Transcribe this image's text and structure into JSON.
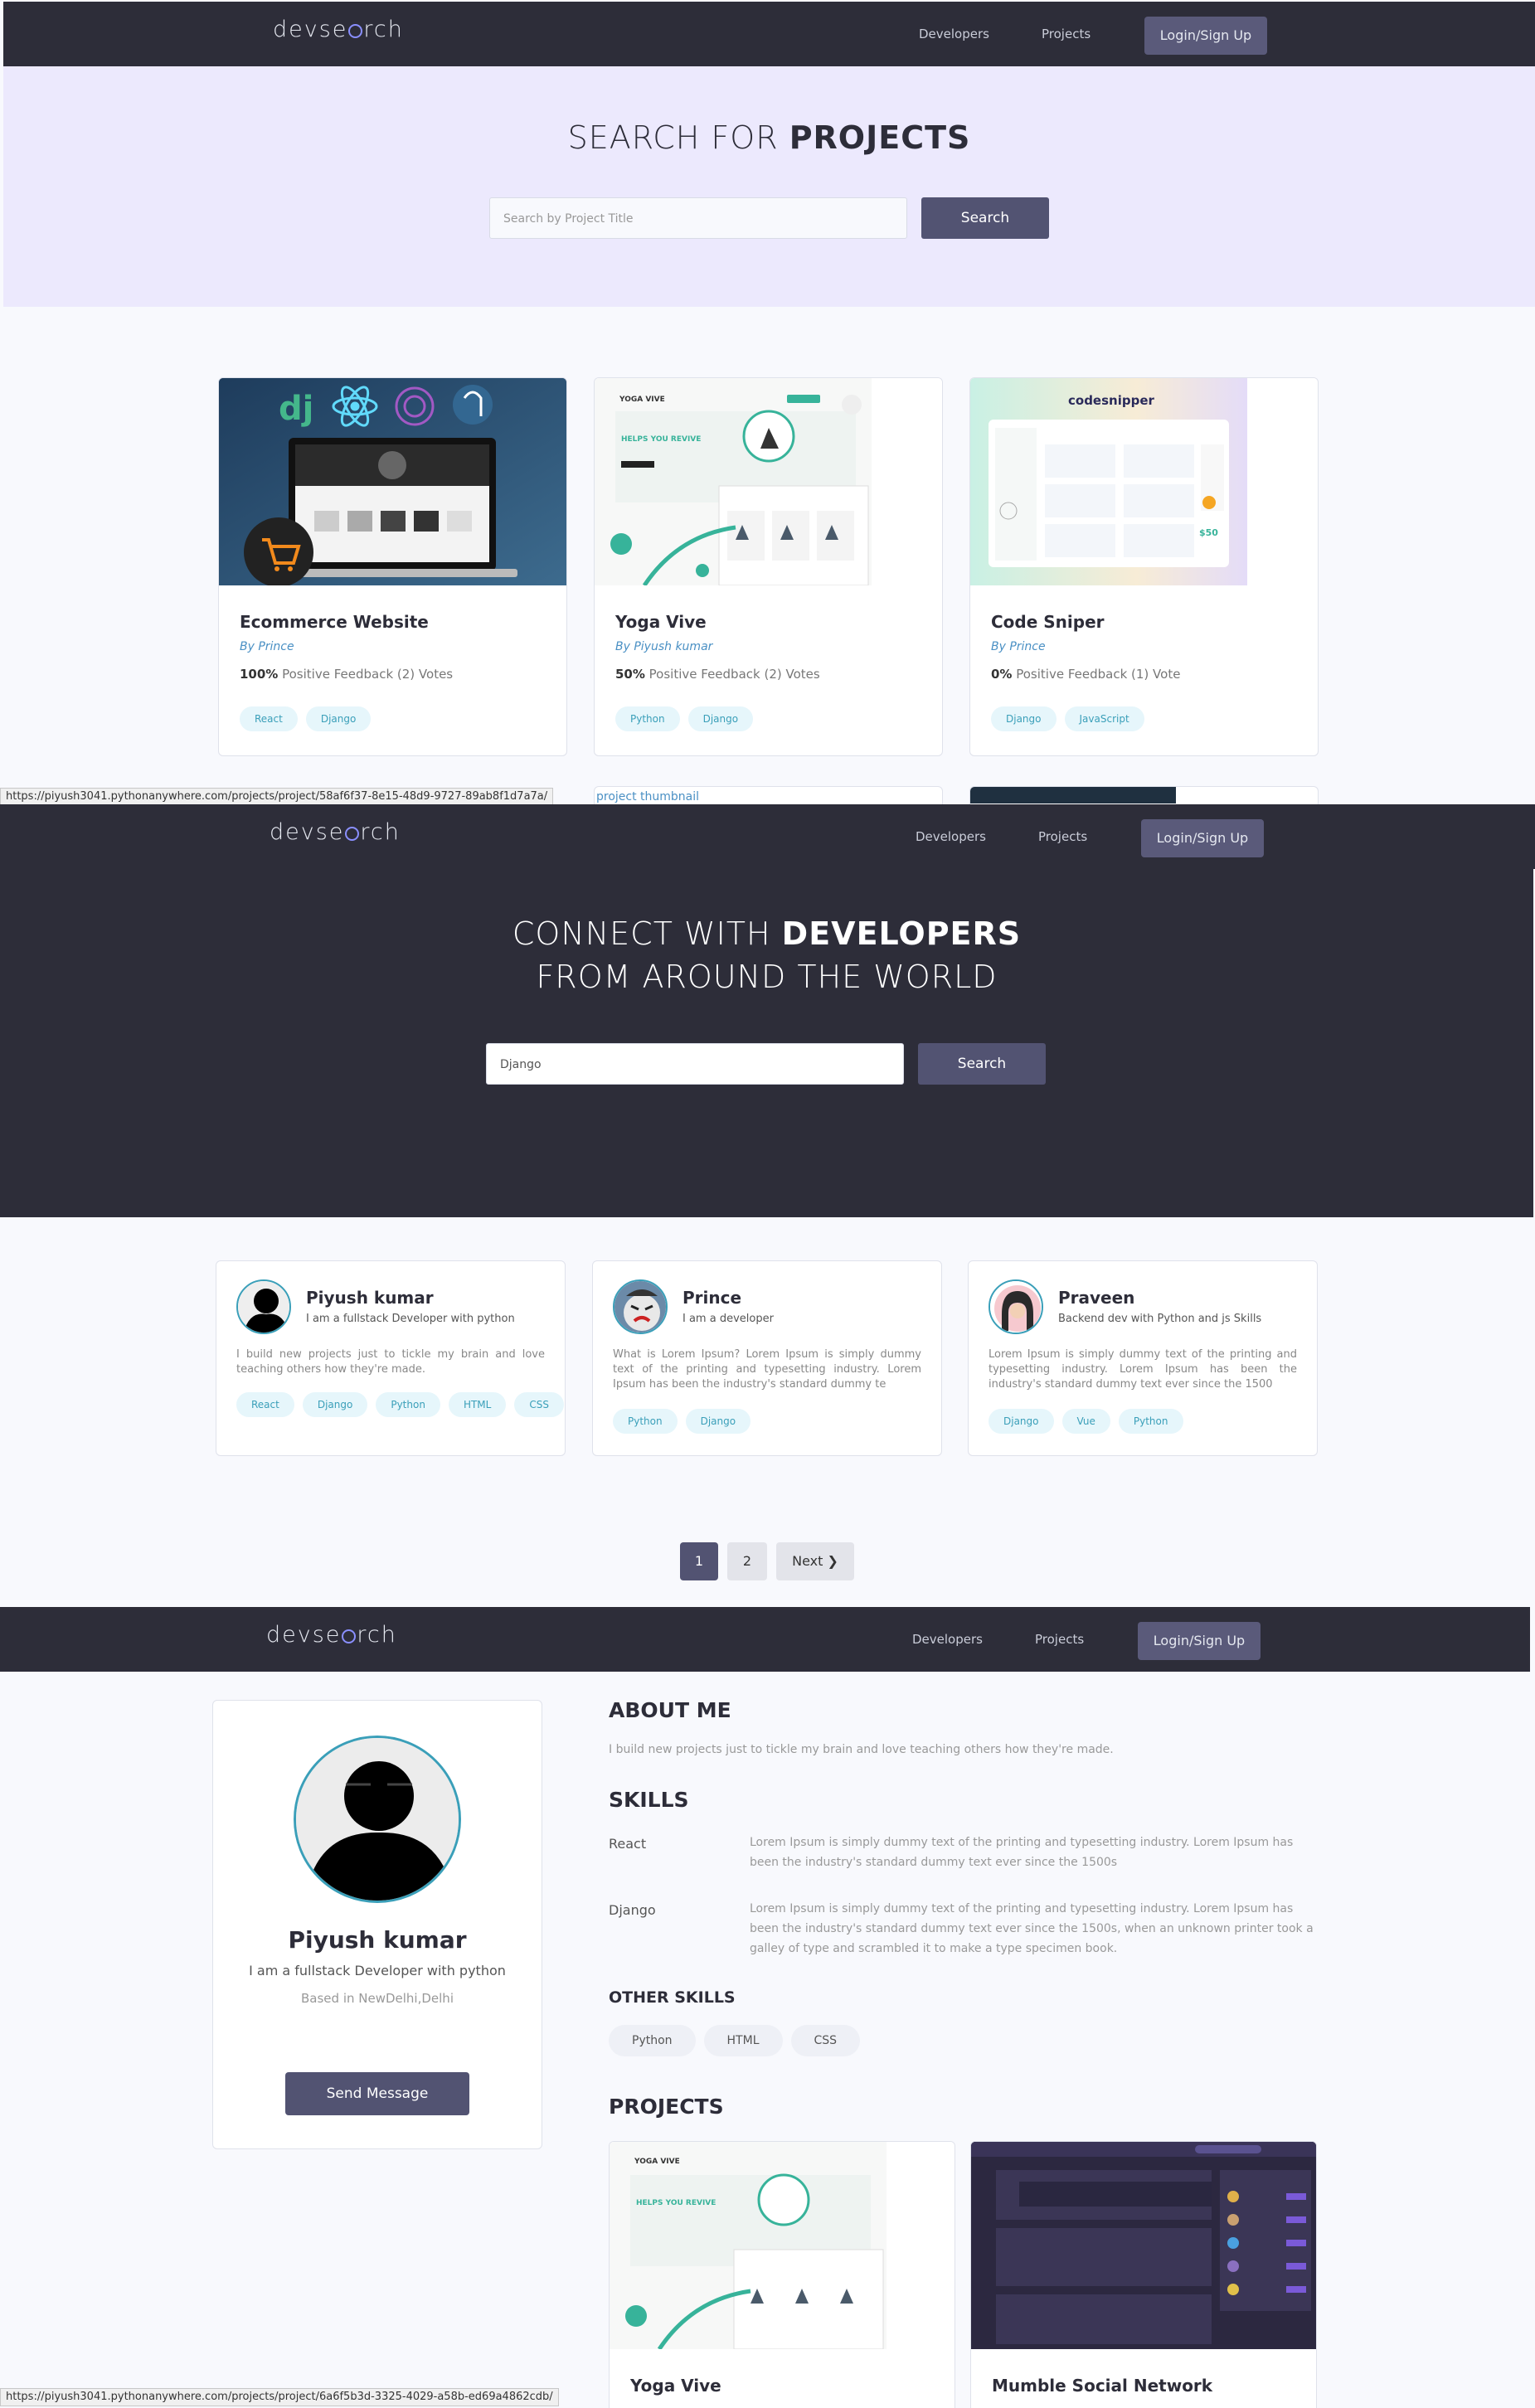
{
  "brand": "devsearch",
  "nav": {
    "developers": "Developers",
    "projects": "Projects",
    "login": "Login/Sign Up"
  },
  "projects_page": {
    "title_light": "SEARCH FOR ",
    "title_bold": "PROJECTS",
    "search_placeholder": "Search by Project Title",
    "search_button": "Search",
    "cards": [
      {
        "title": "Ecommerce Website",
        "author": "By Prince",
        "percent": "100%",
        "feedback": " Positive Feedback (2) Votes",
        "tags": [
          "React",
          "Django"
        ]
      },
      {
        "title": "Yoga Vive",
        "author": "By Piyush kumar",
        "percent": "50%",
        "feedback": " Positive Feedback (2) Votes",
        "tags": [
          "Python",
          "Django"
        ]
      },
      {
        "title": "Code Sniper",
        "author": "By Prince",
        "percent": "0%",
        "feedback": " Positive Feedback (1) Vote",
        "tags": [
          "Django",
          "JavaScript"
        ]
      }
    ],
    "partial_card_text": "project thumbnail",
    "status_url": "https://piyush3041.pythonanywhere.com/projects/project/58af6f37-8e15-48d9-9727-89ab8f1d7a7a/"
  },
  "developers_page": {
    "title_line1_light": "CONNECT WITH ",
    "title_line1_bold": "DEVELOPERS",
    "title_line2": "FROM AROUND THE WORLD",
    "search_value": "Django",
    "search_button": "Search",
    "devs": [
      {
        "name": "Piyush kumar",
        "tagline": "I am a fullstack Developer with python",
        "bio": "I build new projects just to tickle my brain and love teaching others how they're made.",
        "tags": [
          "React",
          "Django",
          "Python",
          "HTML",
          "CSS"
        ]
      },
      {
        "name": "Prince",
        "tagline": "I am a developer",
        "bio": "What is Lorem Ipsum? Lorem Ipsum is simply dummy text of the printing and typesetting industry. Lorem Ipsum has been the industry's standard dummy te",
        "tags": [
          "Python",
          "Django"
        ]
      },
      {
        "name": "Praveen",
        "tagline": "Backend dev with Python and js Skills",
        "bio": "Lorem Ipsum is simply dummy text of the printing and typesetting industry. Lorem Ipsum has been the industry's standard dummy text ever since the 1500",
        "tags": [
          "Django",
          "Vue",
          "Python"
        ]
      }
    ],
    "pagination": {
      "page1": "1",
      "page2": "2",
      "next": "Next ❯"
    }
  },
  "profile_page": {
    "name": "Piyush kumar",
    "tagline": "I am a fullstack Developer with python",
    "location": "Based in NewDelhi,Delhi",
    "send_message": "Send Message",
    "about_heading": "ABOUT ME",
    "about_text": "I build new projects just to tickle my brain and love teaching others how they're made.",
    "skills_heading": "SKILLS",
    "skills": [
      {
        "name": "React",
        "desc": "Lorem Ipsum is simply dummy text of the printing and typesetting industry. Lorem Ipsum has been the industry's standard dummy text ever since the 1500s"
      },
      {
        "name": "Django",
        "desc": "Lorem Ipsum is simply dummy text of the printing and typesetting industry. Lorem Ipsum has been the industry's standard dummy text ever since the 1500s, when an unknown printer took a galley of type and scrambled it to make a type specimen book."
      }
    ],
    "other_skills_heading": "OTHER SKILLS",
    "other_skills": [
      "Python",
      "HTML",
      "CSS"
    ],
    "projects_heading": "PROJECTS",
    "projects": [
      {
        "title": "Yoga Vive"
      },
      {
        "title": "Mumble Social Network"
      }
    ],
    "status_url": "https://piyush3041.pythonanywhere.com/projects/project/6a6f5b3d-3325-4029-a58b-ed69a4862cdb/"
  },
  "colors": {
    "dark": "#2d2d39",
    "accent": "#525372",
    "tag_bg": "#e6f6fb",
    "tag_text": "#3a9fb9",
    "hero_light": "#ece9fd"
  }
}
